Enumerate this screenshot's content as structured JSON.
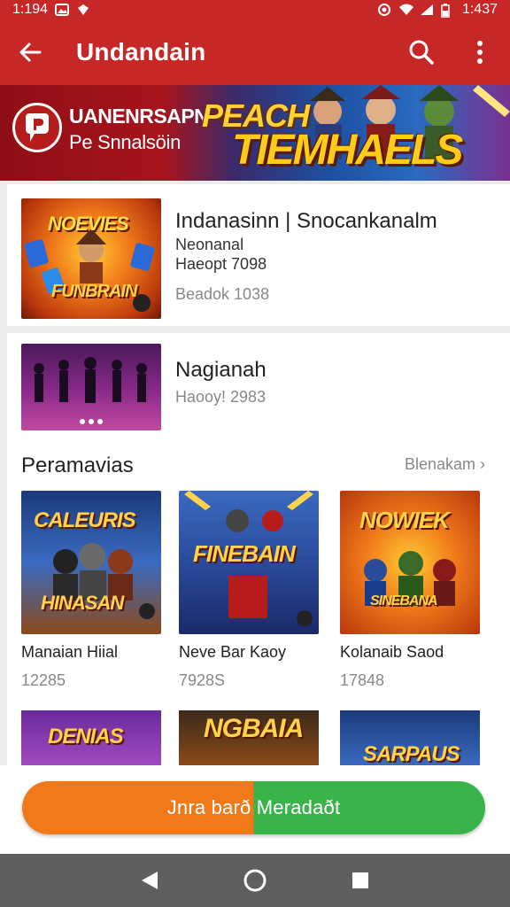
{
  "status_bar": {
    "time_left": "1:194",
    "time_right": "1:437"
  },
  "app_bar": {
    "title": "Undandain"
  },
  "banner": {
    "brand": "UANENRSAPN",
    "subtitle": "Pe Snnalsöin",
    "headline_1": "PEACH",
    "headline_2": "TIEMHAELS"
  },
  "featured": {
    "thumb_text_top": "NOEVIES",
    "thumb_text_bottom": "FUNBRAIN",
    "title": "Indanasinn | Snocankanalm",
    "line_1": "Neonanal",
    "line_2": "Haeopt 7098",
    "meta": "Beadok 1038"
  },
  "second_item": {
    "title": "Nagianah",
    "meta": "Haooy! 2983"
  },
  "section": {
    "title": "Peramavias",
    "link": "Blenakam"
  },
  "games": [
    {
      "name": "Manaian Hiial",
      "count": "12285",
      "top_text": "CALEURIS",
      "bottom_text": "HINASAN"
    },
    {
      "name": "Neve Bar Kaoy",
      "count": "7928S",
      "top_text": "FINEBAIN",
      "bottom_text": ""
    },
    {
      "name": "Kolanaib Saod",
      "count": "17848",
      "top_text": "NOWIEK",
      "bottom_text": "SINEBANA"
    }
  ],
  "games_row2": [
    {
      "top_text": "DENIAS"
    },
    {
      "top_text": "NGBAIA"
    },
    {
      "top_text": "SARPAUS"
    }
  ],
  "cta": {
    "label": "Jnra barð Meradaðt"
  },
  "colors": {
    "app_bar": "#c62828",
    "cta_left": "#f07a1a",
    "cta_right": "#3ab34a"
  }
}
